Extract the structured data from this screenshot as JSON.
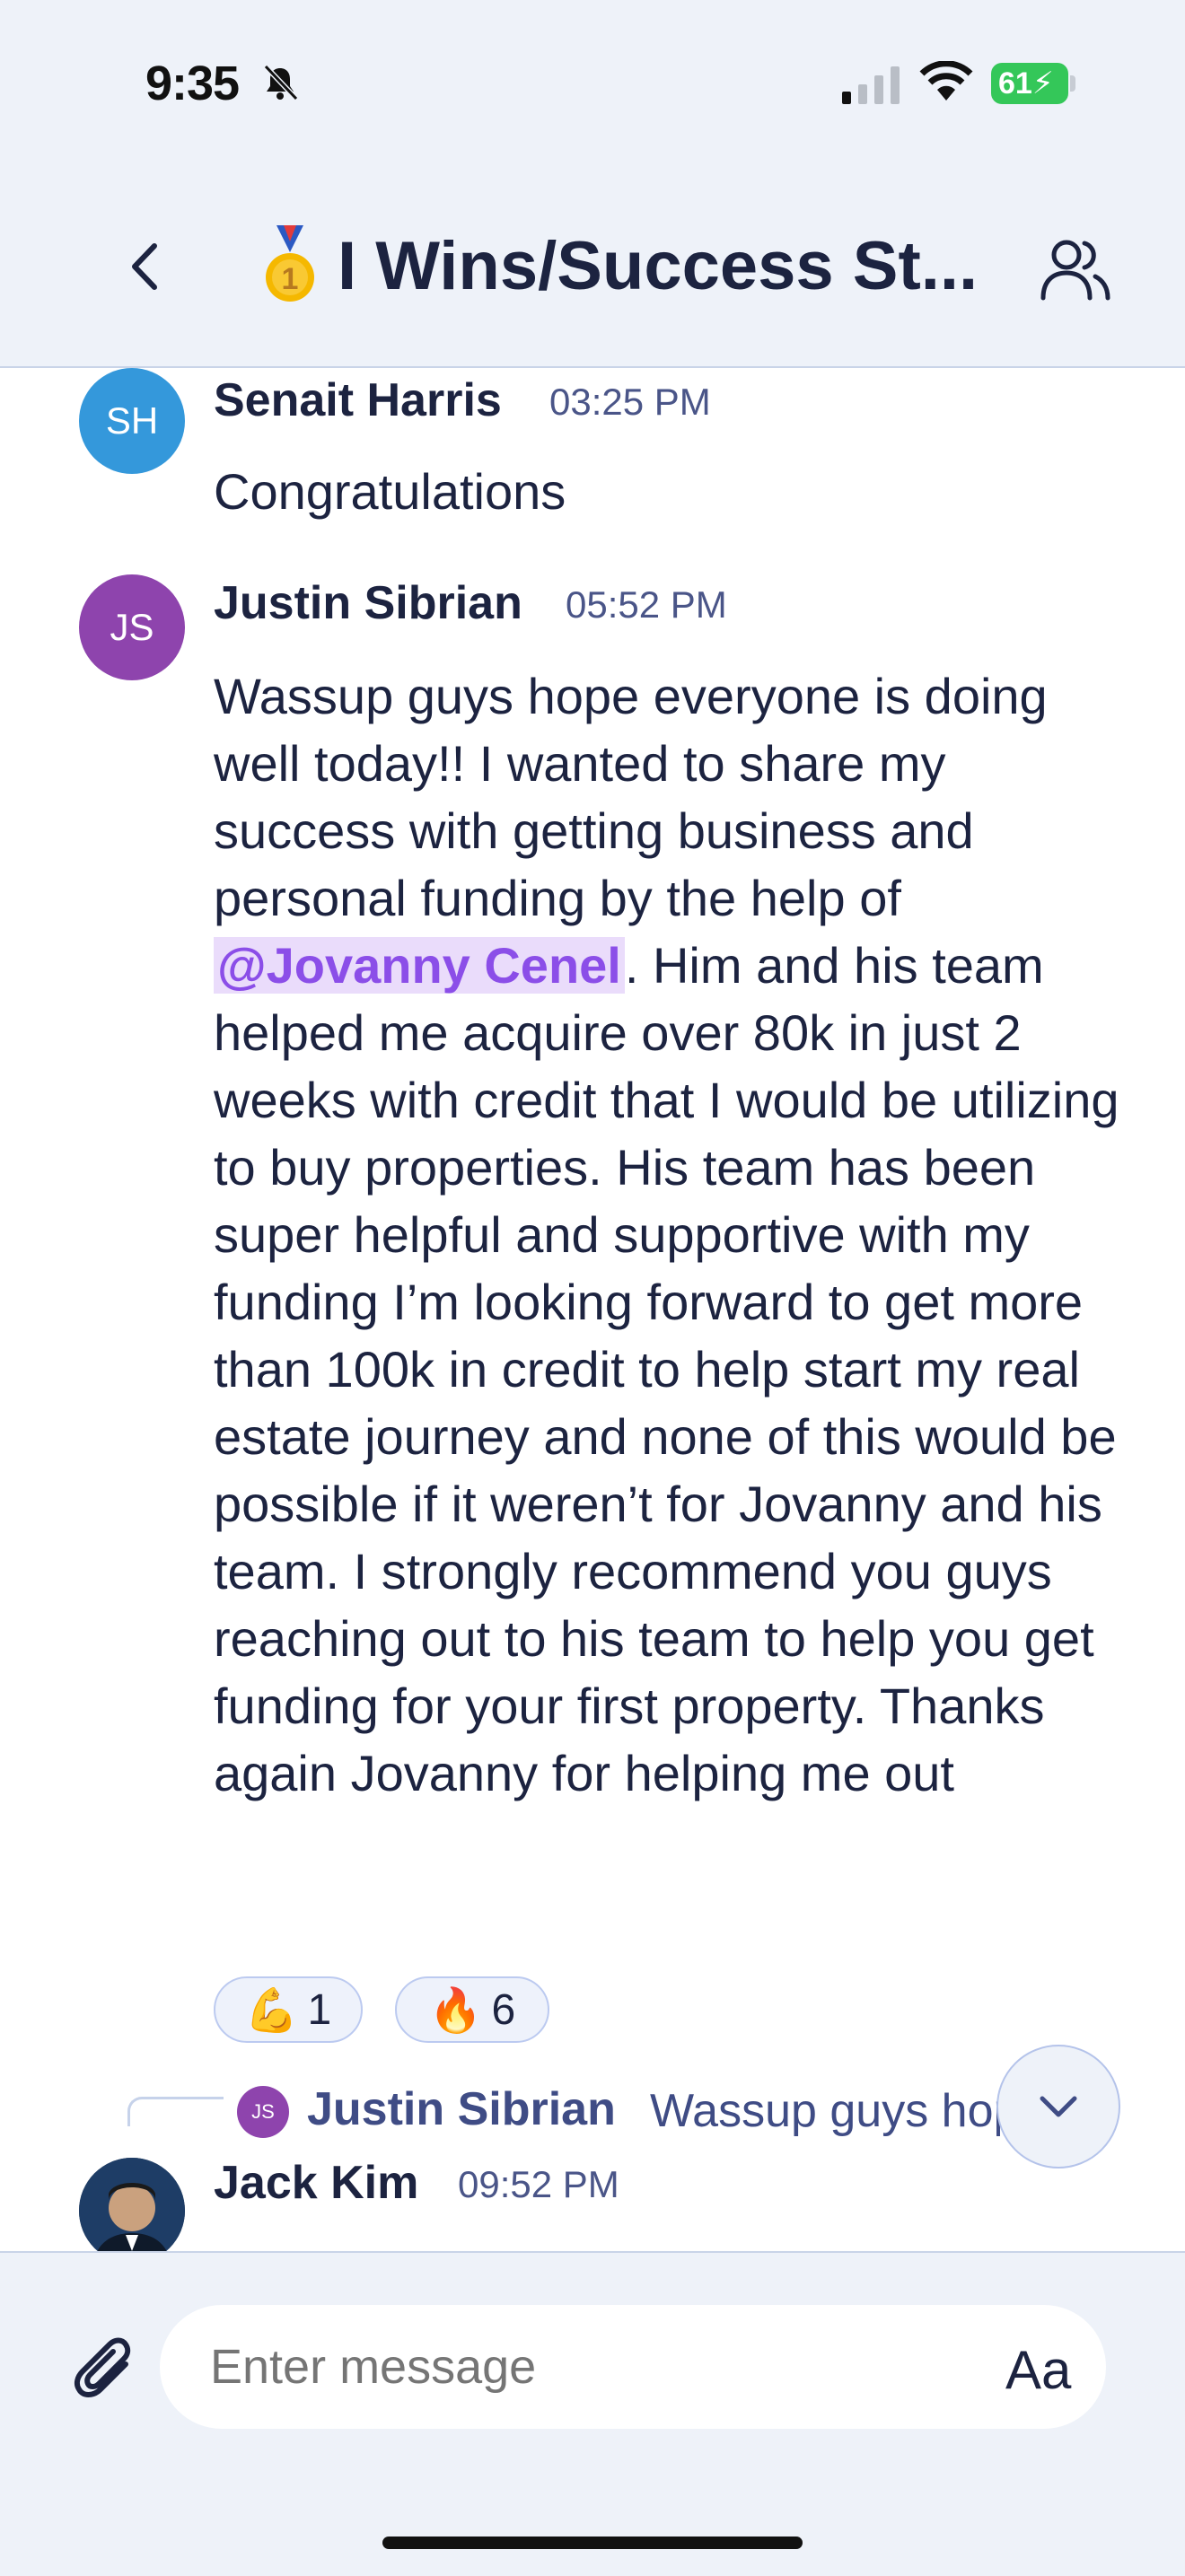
{
  "status_bar": {
    "time": "9:35",
    "battery": "61"
  },
  "header": {
    "title": "I Wins/Success St...",
    "medal_icon": "medal-icon"
  },
  "messages": [
    {
      "initials": "SH",
      "avatar_color": "#3498db",
      "name": "Senait Harris",
      "time": "03:25 PM",
      "text": "Congratulations"
    },
    {
      "initials": "JS",
      "avatar_color": "#8e44ad",
      "name": "Justin Sibrian",
      "time": "05:52 PM",
      "text_before": "Wassup guys hope everyone is doing well today!! I wanted to share my success with getting business and personal funding by the help of ",
      "mention": "@Jovanny Cenel",
      "text_after": ". Him and his team helped me acquire over 80k in just 2 weeks with credit that I would be utilizing to buy properties. His team has been super helpful and supportive with my funding I’m looking forward to get more than 100k in credit to help start my real estate journey and none of this would be possible if it weren’t for Jovanny and his team. I strongly recommend you guys reaching out to his team to help you get funding for your first property. Thanks again Jovanny for helping me out",
      "reactions": [
        {
          "emoji": "💪",
          "count": "1"
        },
        {
          "emoji": "🔥",
          "count": "6"
        }
      ]
    },
    {
      "name": "Jack Kim",
      "time": "09:52 PM"
    }
  ],
  "reply_preview": {
    "initials": "JS",
    "name": "Justin Sibrian",
    "snippet": "Wassup guys hope everyone is doing well today"
  },
  "composer": {
    "placeholder": "Enter message",
    "format_label": "Aa"
  }
}
